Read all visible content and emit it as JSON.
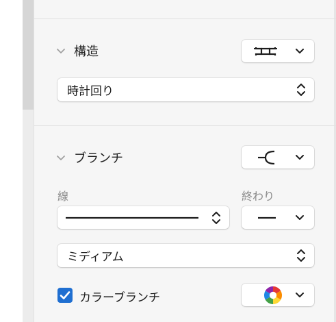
{
  "structure_section": {
    "title": "構造",
    "structure_icon": "structure-icon",
    "direction_value": "時計回り"
  },
  "branch_section": {
    "title": "ブランチ",
    "branch_style_icon": "branch-curve-icon",
    "line_label": "線",
    "end_label": "終わり",
    "line_style_icon": "solid-line-icon",
    "end_style_icon": "short-line-icon",
    "thickness_value": "ミディアム",
    "color_branch_label": "カラーブランチ",
    "color_branch_checked": true,
    "color_picker_icon": "color-wheel-icon"
  },
  "colors": {
    "accent": "#1f6fd1",
    "panel_bg": "#f6f6f6"
  }
}
